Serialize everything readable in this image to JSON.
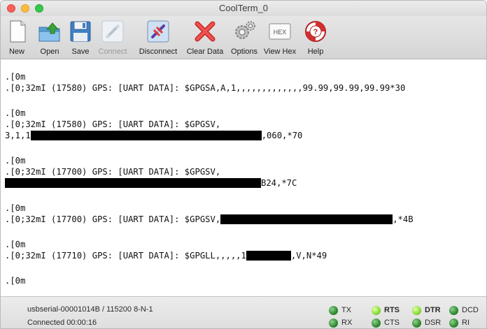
{
  "window": {
    "title": "CoolTerm_0"
  },
  "toolbar": {
    "new": "New",
    "open": "Open",
    "save": "Save",
    "connect": "Connect",
    "disconnect": "Disconnect",
    "clear": "Clear Data",
    "options": "Options",
    "hex": "View Hex",
    "hex_icon_text": "HEX",
    "help": "Help"
  },
  "terminal": {
    "l1": ".[0m",
    "l2": ".[0;32mI (17580) GPS: [UART DATA]: $GPGSA,A,1,,,,,,,,,,,,,99.99,99.99,99.99*30",
    "l3": ".[0m",
    "l4": ".[0;32mI (17580) GPS: [UART DATA]: $GPGSV,",
    "l5a": "3,1,1",
    "l5b": ",060,*70",
    "l6": ".[0m",
    "l7": ".[0;32mI (17700) GPS: [UART DATA]: $GPGSV,",
    "l8b": "B24,*7C",
    "l9": ".[0m",
    "l10a": ".[0;32mI (17700) GPS: [UART DATA]: $GPGSV,",
    "l10b": ",*4B",
    "l11": ".[0m",
    "l12a": ".[0;32mI (17710) GPS: [UART DATA]: $GPGLL,,,,,1",
    "l12b": ",V,N*49",
    "l13": ".[0m"
  },
  "status": {
    "port": "usbserial-00001014B / 115200 8-N-1",
    "connection": "Connected 00:00:16",
    "tx": "TX",
    "rx": "RX",
    "rts": "RTS",
    "cts": "CTS",
    "dtr": "DTR",
    "dsr": "DSR",
    "dcd": "DCD",
    "ri": "RI"
  },
  "colors": {
    "led_on": "#8fe03a",
    "led_idle": "#2f8a2f"
  }
}
